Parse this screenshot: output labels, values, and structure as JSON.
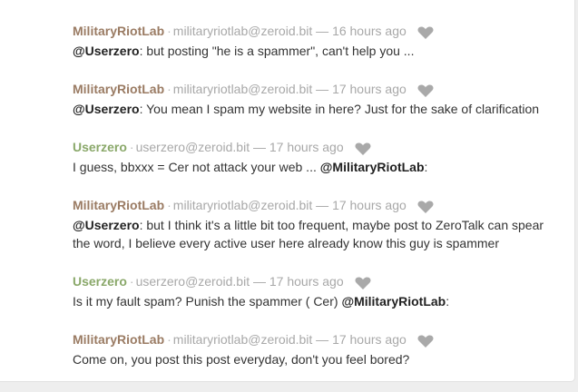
{
  "colors": {
    "military_user": "#9a7b63",
    "zero_user": "#8aa86a",
    "meta": "#a8a8a8",
    "heart": "#a9a9a9"
  },
  "comments": [
    {
      "user": "MilitaryRiotLab",
      "address": "militaryriotlab@zeroid.bit",
      "time": "16 hours ago",
      "mention": "@Userzero",
      "text": ": but posting \"he is a spammer\", can't help you ..."
    },
    {
      "user": "MilitaryRiotLab",
      "address": "militaryriotlab@zeroid.bit",
      "time": "17 hours ago",
      "mention": "@Userzero",
      "text": ": You mean I spam my website in here? Just for the sake of clarification"
    },
    {
      "user": "Userzero",
      "address": "userzero@zeroid.bit",
      "time": "17 hours ago",
      "text_before": "I guess, bbxxx = Cer not attack your web ... ",
      "mention": "@MilitaryRiotLab",
      "text_after": ":"
    },
    {
      "user": "MilitaryRiotLab",
      "address": "militaryriotlab@zeroid.bit",
      "time": "17 hours ago",
      "mention": "@Userzero",
      "text": ": but I think it's a little bit too frequent, maybe post to ZeroTalk can spear the word, I believe every active user here already know this guy is spammer"
    },
    {
      "user": "Userzero",
      "address": "userzero@zeroid.bit",
      "time": "17 hours ago",
      "text_before": "Is it my fault spam? Punish the spammer ( Cer) ",
      "mention": "@MilitaryRiotLab",
      "text_after": ":"
    },
    {
      "user": "MilitaryRiotLab",
      "address": "militaryriotlab@zeroid.bit",
      "time": "17 hours ago",
      "text": "Come on, you post this post everyday, don't you feel bored?"
    }
  ]
}
